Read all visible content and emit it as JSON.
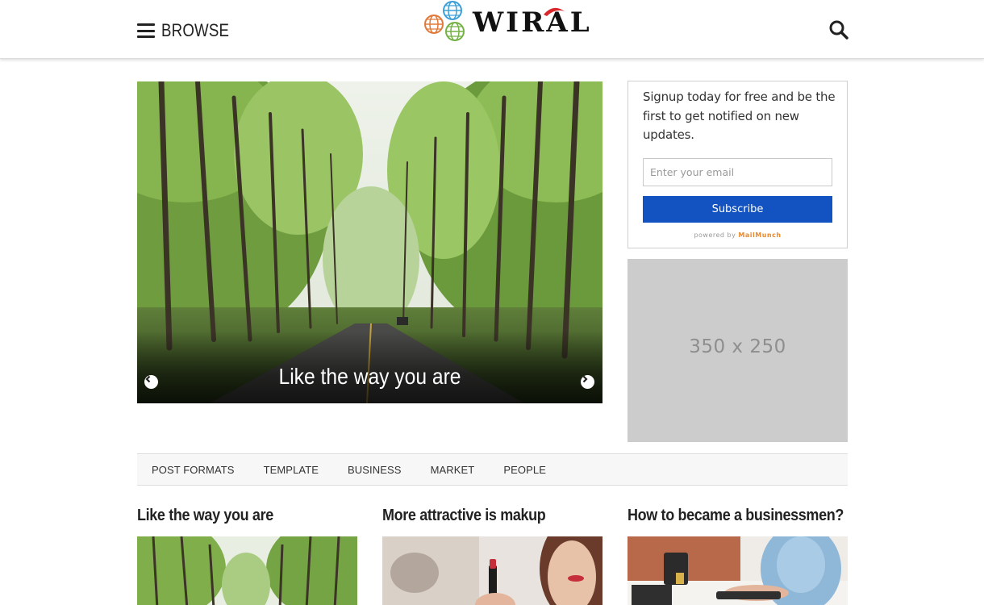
{
  "header": {
    "browse_label": "BROWSE",
    "logo_text": "WIRAL"
  },
  "slider": {
    "title": "Like the way you are"
  },
  "signup": {
    "text": "Signup today for free and be the first to get notified on new updates.",
    "email_placeholder": "Enter your email",
    "subscribe_label": "Subscribe",
    "powered_prefix": "powered by",
    "powered_brand": "MailMunch",
    "button_color": "#1352c1"
  },
  "ad": {
    "label": "350 x 250"
  },
  "categories": [
    "POST FORMATS",
    "TEMPLATE",
    "BUSINESS",
    "MARKET",
    "PEOPLE"
  ],
  "posts": [
    {
      "title": "Like the way you are"
    },
    {
      "title": "More attractive is makup"
    },
    {
      "title": "How to became a businessmen?"
    }
  ],
  "icons": {
    "menu": "hamburger-icon",
    "search": "search-icon",
    "prev": "chevron-left-icon",
    "next": "chevron-right-icon"
  }
}
